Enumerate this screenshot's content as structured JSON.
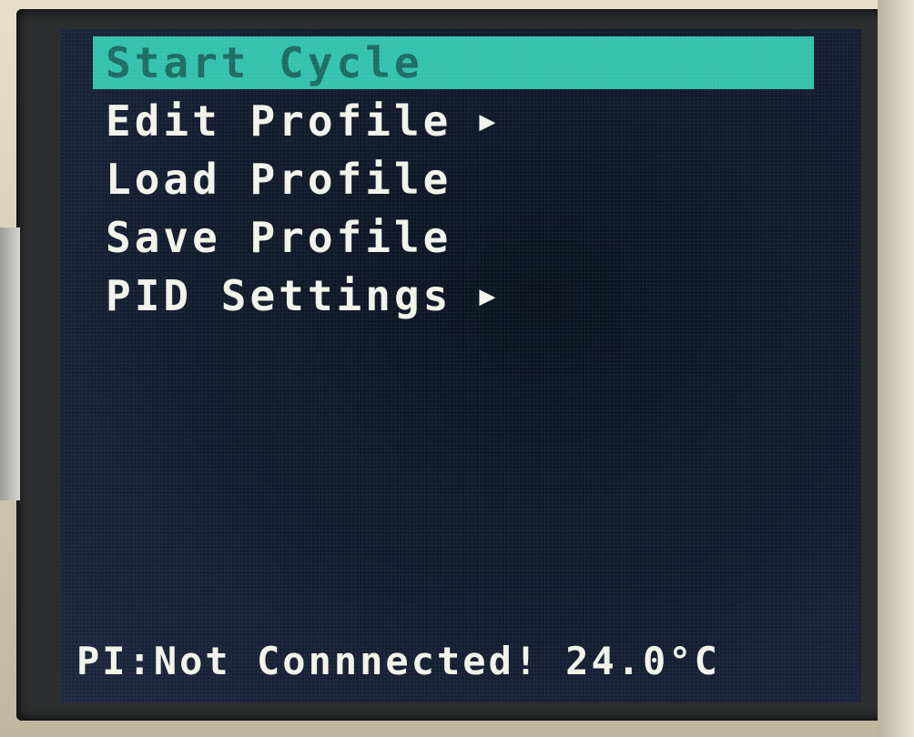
{
  "menu": {
    "items": [
      {
        "label": "Start Cycle",
        "selected": true,
        "has_submenu": false
      },
      {
        "label": "Edit Profile",
        "selected": false,
        "has_submenu": true
      },
      {
        "label": "Load Profile",
        "selected": false,
        "has_submenu": false
      },
      {
        "label": "Save Profile",
        "selected": false,
        "has_submenu": false
      },
      {
        "label": "PID Settings",
        "selected": false,
        "has_submenu": true
      }
    ],
    "submenu_icon": "triangle-right-icon",
    "selected_bg_color": "#33c2ad",
    "selected_text_color": "#1d6c63",
    "text_color": "#f2f4ea"
  },
  "status": {
    "connection": "PI:Not Connnected!",
    "temperature": "24.0°C"
  },
  "colors": {
    "screen_bg": "#131c2e"
  }
}
